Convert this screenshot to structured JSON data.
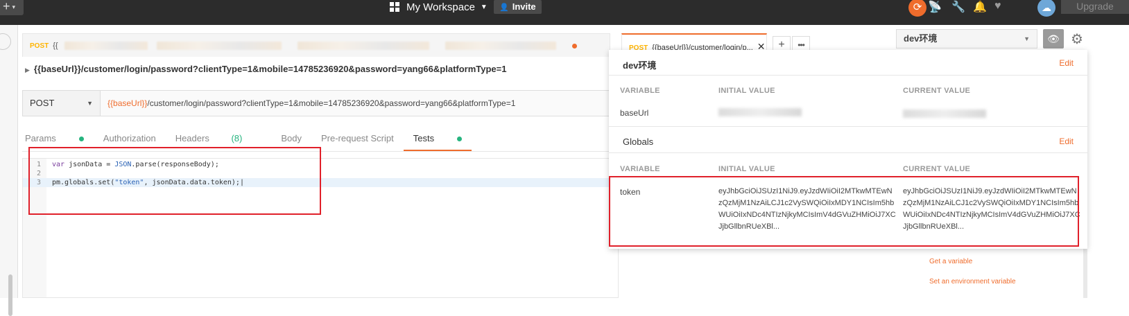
{
  "topbar": {
    "workspace": "My Workspace",
    "invite": "Invite",
    "upgrade": "Upgrade"
  },
  "tabs": [
    {
      "method": "POST",
      "label": "{{"
    },
    {
      "method": "POST",
      "label": "{{baseUrl}}/customer/login/p..."
    }
  ],
  "environment": {
    "selected": "dev环境"
  },
  "request": {
    "title": "{{baseUrl}}/customer/login/password?clientType=1&mobile=14785236920&password=yang66&platformType=1",
    "method": "POST",
    "url_var": "{{baseUrl}}",
    "url_rest": "/customer/login/password?clientType=1&mobile=14785236920&password=yang66&platformType=1"
  },
  "subtabs": {
    "params": "Params",
    "authorization": "Authorization",
    "headers": "Headers",
    "headers_count": "(8)",
    "body": "Body",
    "prerequest": "Pre-request Script",
    "tests": "Tests"
  },
  "editor": {
    "lines": [
      {
        "n": "1",
        "parts": [
          "var",
          " jsonData = ",
          "JSON",
          ".parse(responseBody);"
        ]
      },
      {
        "n": "2"
      },
      {
        "n": "3",
        "parts": [
          "pm.globals.set(",
          "\"token\"",
          ", jsonData.data.token);"
        ]
      }
    ]
  },
  "envpanel": {
    "env_name": "dev环境",
    "edit": "Edit",
    "globals": "Globals",
    "col_variable": "VARIABLE",
    "col_initial": "INITIAL VALUE",
    "col_current": "CURRENT VALUE",
    "var1": "baseUrl",
    "var2": "token",
    "token_initial": "eyJhbGciOiJSUzI1NiJ9.eyJzdWIiOiI2MTkwMTEwNzQzMjM1NzAiLCJ1c2VySWQiOiIxMDY1NCIsIm5hbWUiOiIxNDc4NTIzNjkyMCIsImV4dGVuZHMiOiJ7XCJjbGllbnRUeXBl...",
    "token_current": "eyJhbGciOiJSUzI1NiJ9.eyJzdWIiOiI2MTkwMTEwNzQzMjM1NzAiLCJ1c2VySWQiOiIxMDY1NCIsIm5hbWUiOiIxNDc4NTIzNjkyMCIsImV4dGVuZHMiOiJ7XCJjbGllbnRUeXBl..."
  },
  "snippets": {
    "get_variable": "Get a variable",
    "set_env_variable": "Set an environment variable"
  },
  "colors": {
    "accent": "#ef6c2c",
    "green": "#26b47f",
    "highlight": "#e0202a"
  }
}
